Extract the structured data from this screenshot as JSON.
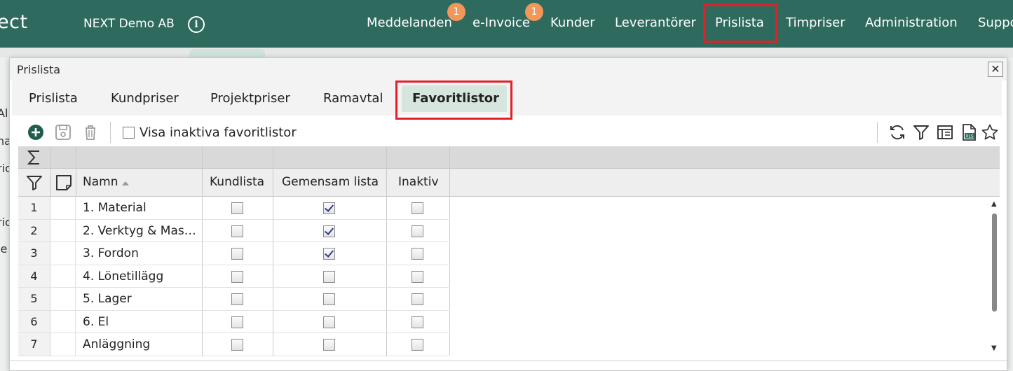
{
  "app": {
    "brand": "ect",
    "company": "NEXT Demo AB",
    "info_icon": "info-icon"
  },
  "nav": {
    "items": [
      {
        "label": "Meddelanden",
        "badge": "1"
      },
      {
        "label": "e-Invoice",
        "badge": "1"
      },
      {
        "label": "Kunder"
      },
      {
        "label": "Leverantörer"
      },
      {
        "label": "Prislista",
        "highlighted": true
      },
      {
        "label": "Timpriser"
      },
      {
        "label": "Administration"
      },
      {
        "label": "Suppo"
      }
    ]
  },
  "background": {
    "fragments": [
      "Al",
      "na",
      "ric",
      "ric",
      "je"
    ]
  },
  "dialog": {
    "title": "Prislista",
    "close_icon": "close-icon",
    "tabs": [
      {
        "label": "Prislista"
      },
      {
        "label": "Kundpriser"
      },
      {
        "label": "Projektpriser"
      },
      {
        "label": "Ramavtal"
      },
      {
        "label": "Favoritlistor",
        "active": true,
        "highlighted": true
      }
    ],
    "toolbar": {
      "left_icons": [
        "add-icon",
        "save-icon",
        "delete-icon"
      ],
      "show_inactive_label": "Visa inaktiva favoritlistor",
      "show_inactive_checked": false,
      "right_icons": [
        "refresh-icon",
        "filter-icon",
        "column-settings-icon",
        "export-xls-icon",
        "favorite-star-icon"
      ],
      "xls_text": "XLS"
    },
    "grid": {
      "sum_icon": "sum-icon",
      "filter_icon": "filter-icon",
      "note_icon": "note-icon",
      "sort_icon": "sort-ascending-icon",
      "columns": [
        "Namn",
        "Kundlista",
        "Gemensam lista",
        "Inaktiv"
      ],
      "rows": [
        {
          "num": "1",
          "name": "1. Material",
          "kundlista": false,
          "gemensam": true,
          "inaktiv": false
        },
        {
          "num": "2",
          "name": "2. Verktyg & Mask…",
          "kundlista": false,
          "gemensam": true,
          "inaktiv": false
        },
        {
          "num": "3",
          "name": "3. Fordon",
          "kundlista": false,
          "gemensam": true,
          "inaktiv": false
        },
        {
          "num": "4",
          "name": "4. Lönetillägg",
          "kundlista": false,
          "gemensam": false,
          "inaktiv": false
        },
        {
          "num": "5",
          "name": "5. Lager",
          "kundlista": false,
          "gemensam": false,
          "inaktiv": false
        },
        {
          "num": "6",
          "name": "6. El",
          "kundlista": false,
          "gemensam": false,
          "inaktiv": false
        },
        {
          "num": "7",
          "name": "Anläggning",
          "kundlista": false,
          "gemensam": false,
          "inaktiv": false
        }
      ]
    }
  },
  "colors": {
    "topbar": "#2e6b5e",
    "badge": "#f2965a",
    "highlight": "#e2202a",
    "active_tab": "#d7e5df",
    "add_icon": "#1f5e4e"
  }
}
